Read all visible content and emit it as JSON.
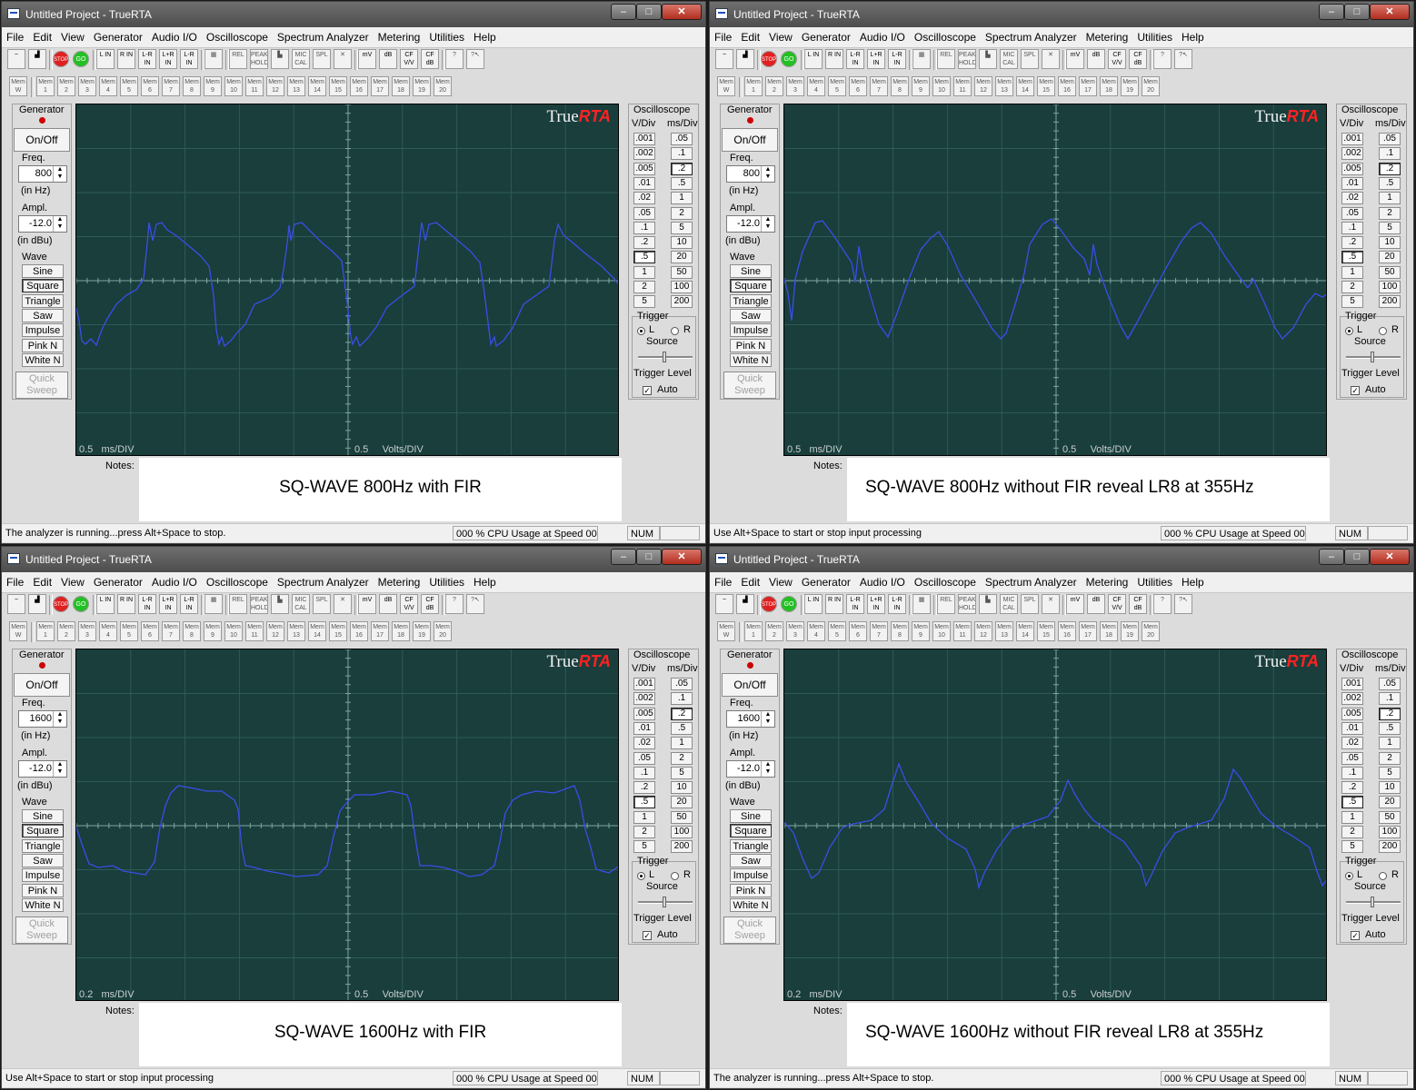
{
  "common": {
    "window_title": "Untitled Project - TrueRTA",
    "menu": [
      "File",
      "Edit",
      "View",
      "Generator",
      "Audio I/O",
      "Oscilloscope",
      "Spectrum Analyzer",
      "Metering",
      "Utilities",
      "Help"
    ],
    "toolbar1": [
      {
        "name": "oscilloscope-view-button",
        "label": "~"
      },
      {
        "name": "spectrum-view-button",
        "label": "▟"
      },
      {
        "name": "stop-button",
        "label": "STOP"
      },
      {
        "name": "go-button",
        "label": "GO"
      },
      {
        "name": "l-in-button",
        "label": "L IN"
      },
      {
        "name": "r-in-button",
        "label": "R IN"
      },
      {
        "name": "l-r-in-button",
        "label": "L-R IN"
      },
      {
        "name": "lr-sum-in-button",
        "label": "L+R IN"
      },
      {
        "name": "l-minus-r-in-button",
        "label": "L-R IN"
      },
      {
        "name": "grid-button",
        "label": "▦"
      },
      {
        "name": "rel-button",
        "label": "REL"
      },
      {
        "name": "peak-hold-button",
        "label": "PEAK HOLD"
      },
      {
        "name": "bars-button",
        "label": "▙"
      },
      {
        "name": "mic-cal-button",
        "label": "MIC CAL"
      },
      {
        "name": "spl-button",
        "label": "SPL"
      },
      {
        "name": "cross-button",
        "label": "✕"
      },
      {
        "name": "mv-button",
        "label": "mV"
      },
      {
        "name": "db-button",
        "label": "dB"
      },
      {
        "name": "cf-vv-button",
        "label": "CF V/V"
      },
      {
        "name": "cf-db-button",
        "label": "CF dB"
      },
      {
        "name": "help-button",
        "label": "?"
      },
      {
        "name": "context-help-button",
        "label": "?↖"
      }
    ],
    "mem_w": "Mem W",
    "mem_label": "Mem",
    "mem_slots": [
      "1",
      "2",
      "3",
      "4",
      "5",
      "6",
      "7",
      "8",
      "9",
      "10",
      "11",
      "12",
      "13",
      "14",
      "15",
      "16",
      "17",
      "18",
      "19",
      "20"
    ],
    "generator": {
      "title": "Generator",
      "on_off": "On/Off",
      "freq_label": "Freq.",
      "freq_unit": "(in Hz)",
      "ampl_label": "Ampl.",
      "ampl_value": "-12.0",
      "ampl_unit": "(in dBu)",
      "wave_label": "Wave",
      "waves": [
        "Sine",
        "Square",
        "Triangle",
        "Saw",
        "Impulse",
        "Pink N",
        "White N"
      ],
      "selected_wave": "Square",
      "quick_sweep": "Quick Sweep"
    },
    "oscilloscope": {
      "title": "Oscilloscope",
      "vdiv_label": "V/Div",
      "msdiv_label": "ms/Div",
      "vdiv": [
        ".001",
        ".002",
        ".005",
        ".01",
        ".02",
        ".05",
        ".1",
        ".2",
        ".5",
        "1",
        "2",
        "5"
      ],
      "msdiv": [
        ".05",
        ".1",
        ".2",
        ".5",
        "1",
        "2",
        "5",
        "10",
        "20",
        "50",
        "100",
        "200"
      ],
      "trigger_label": "Trigger",
      "source_l": "L",
      "source_r": "R",
      "source_label": "Source",
      "trigger_level": "Trigger Level",
      "auto_label": "Auto",
      "auto_checked": true
    },
    "brand_true": "True",
    "brand_rta": "RTA",
    "notes_label": "Notes:",
    "ms_div_unit": "ms/DIV",
    "volts_div_unit": "Volts/DIV",
    "cpu": "000 % CPU Usage at Speed 00",
    "num": "NUM",
    "trace_color": "#3a4ee8",
    "scope_bg": "#193e3c",
    "grid_color": "#2e5a57",
    "axis_color": "#7fa6a2"
  },
  "windows": [
    {
      "id": "top-left",
      "freq": "800",
      "ms_div_value": "0.5",
      "volts_div_value": "0.5",
      "selected_vdiv": ".5",
      "selected_msdiv": ".2",
      "notes_text": "SQ-WAVE 800Hz with FIR",
      "status_text": "The analyzer is running...press Alt+Space to stop.",
      "trace": [
        [
          0,
          164
        ],
        [
          3,
          150
        ],
        [
          6,
          128
        ],
        [
          10,
          124
        ],
        [
          16,
          130
        ],
        [
          22,
          123
        ],
        [
          28,
          140
        ],
        [
          34,
          152
        ],
        [
          44,
          168
        ],
        [
          55,
          178
        ],
        [
          66,
          184
        ],
        [
          74,
          196
        ],
        [
          78,
          235
        ],
        [
          80,
          258
        ],
        [
          84,
          238
        ],
        [
          88,
          256
        ],
        [
          94,
          258
        ],
        [
          100,
          250
        ],
        [
          112,
          242
        ],
        [
          124,
          232
        ],
        [
          136,
          222
        ],
        [
          146,
          210
        ],
        [
          151,
          178
        ],
        [
          154,
          140
        ],
        [
          157,
          124
        ],
        [
          160,
          132
        ],
        [
          163,
          122
        ],
        [
          170,
          128
        ],
        [
          178,
          138
        ],
        [
          186,
          146
        ],
        [
          196,
          168
        ],
        [
          214,
          176
        ],
        [
          224,
          186
        ],
        [
          228,
          206
        ],
        [
          232,
          235
        ],
        [
          234,
          255
        ],
        [
          236,
          238
        ],
        [
          240,
          256
        ],
        [
          248,
          258
        ],
        [
          258,
          248
        ],
        [
          270,
          236
        ],
        [
          282,
          226
        ],
        [
          292,
          216
        ],
        [
          298,
          170
        ],
        [
          302,
          132
        ],
        [
          304,
          124
        ],
        [
          308,
          132
        ],
        [
          312,
          122
        ],
        [
          320,
          130
        ],
        [
          330,
          143
        ],
        [
          342,
          165
        ],
        [
          356,
          176
        ],
        [
          372,
          188
        ],
        [
          377,
          233
        ],
        [
          380,
          258
        ],
        [
          384,
          238
        ],
        [
          388,
          256
        ],
        [
          396,
          258
        ],
        [
          408,
          248
        ],
        [
          420,
          238
        ],
        [
          434,
          226
        ],
        [
          444,
          214
        ],
        [
          449,
          180
        ],
        [
          454,
          140
        ],
        [
          456,
          124
        ],
        [
          460,
          132
        ],
        [
          462,
          122
        ],
        [
          470,
          128
        ],
        [
          480,
          142
        ],
        [
          492,
          168
        ],
        [
          506,
          178
        ],
        [
          520,
          188
        ],
        [
          526,
          238
        ],
        [
          530,
          256
        ],
        [
          536,
          244
        ],
        [
          546,
          236
        ],
        [
          560,
          224
        ],
        [
          578,
          210
        ],
        [
          592,
          196
        ],
        [
          598,
          188
        ]
      ]
    },
    {
      "id": "top-right",
      "freq": "800",
      "ms_div_value": "0.5",
      "volts_div_value": "0.5",
      "selected_vdiv": ".5",
      "selected_msdiv": ".2",
      "notes_text": "SQ-WAVE 800Hz without FIR reveal LR8 at 355Hz",
      "status_text": "Use Alt+Space to start or stop input processing",
      "trace": [
        [
          0,
          196
        ],
        [
          4,
          180
        ],
        [
          8,
          150
        ],
        [
          12,
          196
        ],
        [
          20,
          226
        ],
        [
          34,
          258
        ],
        [
          42,
          260
        ],
        [
          54,
          244
        ],
        [
          66,
          226
        ],
        [
          74,
          214
        ],
        [
          78,
          192
        ],
        [
          82,
          232
        ],
        [
          86,
          208
        ],
        [
          94,
          180
        ],
        [
          104,
          146
        ],
        [
          114,
          132
        ],
        [
          124,
          158
        ],
        [
          138,
          198
        ],
        [
          150,
          228
        ],
        [
          160,
          240
        ],
        [
          170,
          248
        ],
        [
          180,
          232
        ],
        [
          194,
          200
        ],
        [
          212,
          170
        ],
        [
          228,
          142
        ],
        [
          238,
          130
        ],
        [
          244,
          136
        ],
        [
          254,
          168
        ],
        [
          264,
          202
        ],
        [
          270,
          234
        ],
        [
          284,
          256
        ],
        [
          294,
          262
        ],
        [
          304,
          250
        ],
        [
          318,
          230
        ],
        [
          330,
          218
        ],
        [
          336,
          200
        ],
        [
          340,
          234
        ],
        [
          344,
          212
        ],
        [
          356,
          178
        ],
        [
          370,
          144
        ],
        [
          378,
          130
        ],
        [
          388,
          148
        ],
        [
          404,
          178
        ],
        [
          420,
          208
        ],
        [
          436,
          236
        ],
        [
          448,
          252
        ],
        [
          458,
          258
        ],
        [
          470,
          246
        ],
        [
          484,
          222
        ],
        [
          498,
          202
        ],
        [
          510,
          186
        ],
        [
          516,
          196
        ],
        [
          528,
          170
        ],
        [
          540,
          142
        ],
        [
          548,
          130
        ],
        [
          560,
          142
        ],
        [
          574,
          168
        ],
        [
          584,
          180
        ],
        [
          592,
          176
        ],
        [
          598,
          180
        ]
      ]
    },
    {
      "id": "bottom-left",
      "freq": "1600",
      "ms_div_value": "0.2",
      "volts_div_value": "0.5",
      "selected_vdiv": ".5",
      "selected_msdiv": ".2",
      "notes_text": "SQ-WAVE 1600Hz with FIR",
      "status_text": "Use Alt+Space to start or stop input processing",
      "trace": [
        [
          0,
          192
        ],
        [
          6,
          174
        ],
        [
          14,
          152
        ],
        [
          24,
          148
        ],
        [
          40,
          150
        ],
        [
          52,
          144
        ],
        [
          64,
          142
        ],
        [
          76,
          140
        ],
        [
          86,
          154
        ],
        [
          92,
          192
        ],
        [
          98,
          216
        ],
        [
          104,
          230
        ],
        [
          112,
          238
        ],
        [
          124,
          236
        ],
        [
          144,
          232
        ],
        [
          160,
          232
        ],
        [
          174,
          222
        ],
        [
          178,
          212
        ],
        [
          182,
          170
        ],
        [
          186,
          150
        ],
        [
          196,
          148
        ],
        [
          210,
          144
        ],
        [
          222,
          142
        ],
        [
          242,
          138
        ],
        [
          266,
          140
        ],
        [
          276,
          150
        ],
        [
          282,
          178
        ],
        [
          290,
          210
        ],
        [
          298,
          220
        ],
        [
          306,
          228
        ],
        [
          326,
          228
        ],
        [
          346,
          232
        ],
        [
          364,
          228
        ],
        [
          368,
          216
        ],
        [
          374,
          174
        ],
        [
          378,
          150
        ],
        [
          390,
          150
        ],
        [
          404,
          148
        ],
        [
          418,
          144
        ],
        [
          432,
          138
        ],
        [
          446,
          140
        ],
        [
          460,
          150
        ],
        [
          466,
          176
        ],
        [
          472,
          208
        ],
        [
          480,
          222
        ],
        [
          490,
          228
        ],
        [
          506,
          232
        ],
        [
          526,
          230
        ],
        [
          548,
          238
        ],
        [
          554,
          222
        ],
        [
          560,
          190
        ],
        [
          566,
          170
        ],
        [
          572,
          146
        ],
        [
          586,
          142
        ],
        [
          598,
          150
        ]
      ]
    },
    {
      "id": "bottom-right",
      "freq": "1600",
      "ms_div_value": "0.2",
      "volts_div_value": "0.5",
      "selected_vdiv": ".5",
      "selected_msdiv": ".2",
      "notes_text": "SQ-WAVE 1600Hz without FIR reveal LR8 at 355Hz",
      "status_text": "The analyzer is running...press Alt+Space to stop.",
      "trace": [
        [
          0,
          198
        ],
        [
          10,
          186
        ],
        [
          20,
          158
        ],
        [
          30,
          136
        ],
        [
          38,
          142
        ],
        [
          50,
          170
        ],
        [
          64,
          192
        ],
        [
          76,
          196
        ],
        [
          96,
          200
        ],
        [
          110,
          212
        ],
        [
          118,
          238
        ],
        [
          126,
          262
        ],
        [
          134,
          242
        ],
        [
          148,
          220
        ],
        [
          162,
          196
        ],
        [
          180,
          180
        ],
        [
          200,
          168
        ],
        [
          210,
          146
        ],
        [
          214,
          126
        ],
        [
          220,
          142
        ],
        [
          234,
          168
        ],
        [
          250,
          190
        ],
        [
          266,
          196
        ],
        [
          290,
          204
        ],
        [
          304,
          222
        ],
        [
          312,
          244
        ],
        [
          320,
          228
        ],
        [
          330,
          212
        ],
        [
          340,
          200
        ],
        [
          356,
          188
        ],
        [
          374,
          176
        ],
        [
          392,
          150
        ],
        [
          398,
          128
        ],
        [
          404,
          140
        ],
        [
          416,
          166
        ],
        [
          430,
          186
        ],
        [
          444,
          192
        ],
        [
          470,
          200
        ],
        [
          484,
          224
        ],
        [
          494,
          256
        ],
        [
          502,
          246
        ],
        [
          510,
          232
        ],
        [
          524,
          208
        ],
        [
          540,
          194
        ],
        [
          560,
          182
        ],
        [
          578,
          170
        ],
        [
          586,
          144
        ],
        [
          592,
          128
        ],
        [
          598,
          136
        ]
      ]
    }
  ]
}
